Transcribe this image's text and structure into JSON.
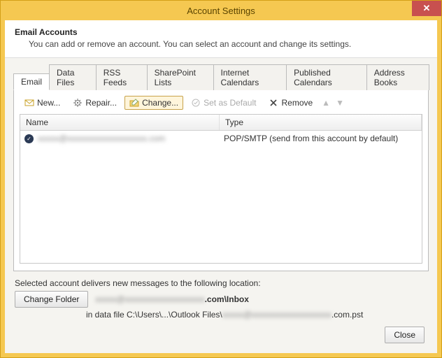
{
  "window": {
    "title": "Account Settings"
  },
  "header": {
    "title": "Email Accounts",
    "subtitle": "You can add or remove an account. You can select an account and change its settings."
  },
  "tabs": [
    {
      "label": "Email",
      "active": true
    },
    {
      "label": "Data Files"
    },
    {
      "label": "RSS Feeds"
    },
    {
      "label": "SharePoint Lists"
    },
    {
      "label": "Internet Calendars"
    },
    {
      "label": "Published Calendars"
    },
    {
      "label": "Address Books"
    }
  ],
  "toolbar": {
    "new": "New...",
    "repair": "Repair...",
    "change": "Change...",
    "set_default": "Set as Default",
    "remove": "Remove"
  },
  "grid": {
    "columns": {
      "name": "Name",
      "type": "Type"
    },
    "rows": [
      {
        "name_masked": "xxxxx@xxxxxxxxxxxxxxxxxxx.com",
        "type": "POP/SMTP (send from this account by default)"
      }
    ]
  },
  "delivery": {
    "label": "Selected account delivers new messages to the following location:",
    "change_folder": "Change Folder",
    "folder_suffix": ".com\\Inbox",
    "folder_masked": "xxxxx@xxxxxxxxxxxxxxxxxxx",
    "path_prefix": "in data file C:\\Users\\...\\Outlook Files\\",
    "path_masked": "xxxxx@xxxxxxxxxxxxxxxxxxx",
    "path_suffix": ".com.pst"
  },
  "footer": {
    "close": "Close"
  }
}
